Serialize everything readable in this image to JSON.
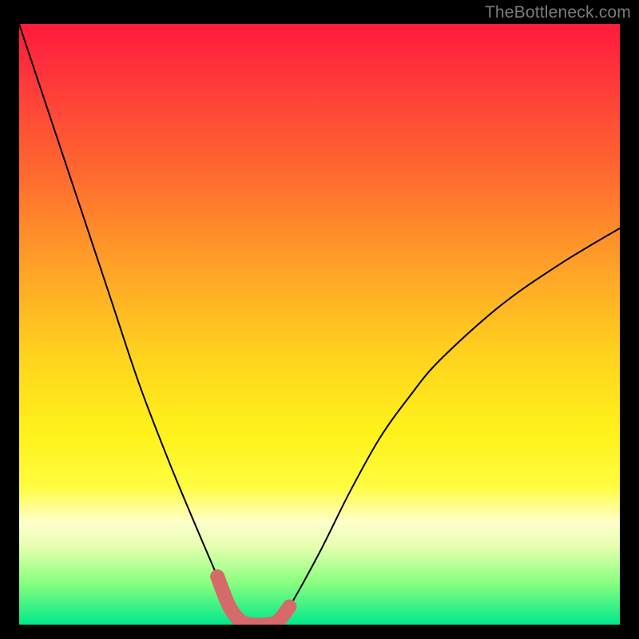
{
  "watermark": {
    "text": "TheBottleneck.com"
  },
  "colors": {
    "curve_stroke": "#000000",
    "highlight": "#d66a6a",
    "background": "#000000"
  },
  "chart_data": {
    "type": "line",
    "title": "",
    "xlabel": "",
    "ylabel": "",
    "xlim": [
      0,
      100
    ],
    "ylim": [
      0,
      100
    ],
    "grid": false,
    "series": [
      {
        "name": "bottleneck-curve",
        "x": [
          0,
          5,
          10,
          15,
          20,
          25,
          30,
          33,
          35,
          37,
          39,
          41,
          43,
          45,
          50,
          55,
          60,
          65,
          70,
          80,
          90,
          100
        ],
        "values": [
          100,
          85,
          70,
          55,
          40,
          27,
          15,
          8,
          3,
          0.5,
          0,
          0,
          0.5,
          3,
          12,
          22,
          31,
          38,
          44,
          53,
          60,
          66
        ]
      }
    ],
    "annotations": [
      {
        "name": "trough-highlight",
        "type": "range-marker",
        "x_start": 33,
        "x_end": 45,
        "style": "thick-rounded",
        "color": "#d66a6a"
      }
    ]
  }
}
